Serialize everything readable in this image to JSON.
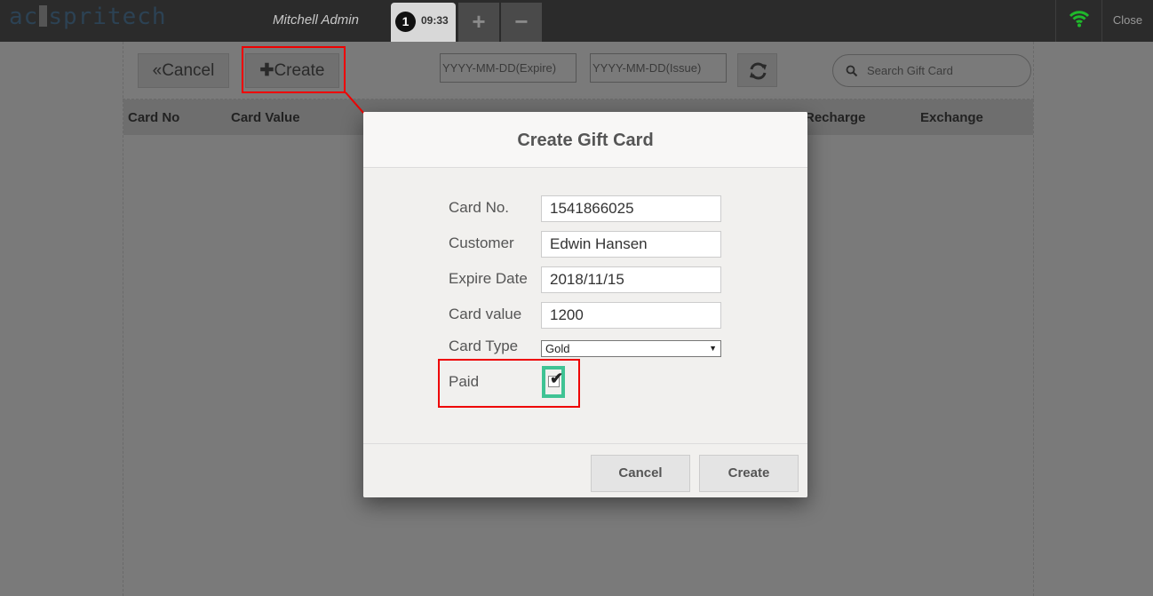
{
  "topbar": {
    "logo_left": "ac",
    "logo_right": "spritech",
    "user_name": "Mitchell Admin",
    "order": {
      "number": "1",
      "time": "09:33"
    },
    "add_tab": "+",
    "remove_tab": "−",
    "close_label": "Close"
  },
  "toolbar": {
    "cancel_label": "Cancel",
    "create_label": "Create",
    "expire_placeholder": "YYYY-MM-DD(Expire)",
    "issue_placeholder": "YYYY-MM-DD(Issue)",
    "search_placeholder": "Search Gift Card"
  },
  "table": {
    "columns": [
      "Card No",
      "Card Value",
      "Recharge",
      "Exchange"
    ]
  },
  "modal": {
    "title": "Create Gift Card",
    "fields": {
      "card_no": {
        "label": "Card No.",
        "value": "1541866025"
      },
      "customer": {
        "label": "Customer",
        "value": "Edwin Hansen"
      },
      "expire_date": {
        "label": "Expire Date",
        "value": "2018/11/15"
      },
      "card_value": {
        "label": "Card value",
        "value": "1200"
      },
      "card_type": {
        "label": "Card Type",
        "value": "Gold"
      },
      "paid": {
        "label": "Paid",
        "checked": true
      }
    },
    "cancel_label": "Cancel",
    "create_label": "Create"
  },
  "colors": {
    "highlight_red": "#e00000",
    "highlight_green": "#3fc394",
    "wifi_green": "#1fb82b"
  }
}
